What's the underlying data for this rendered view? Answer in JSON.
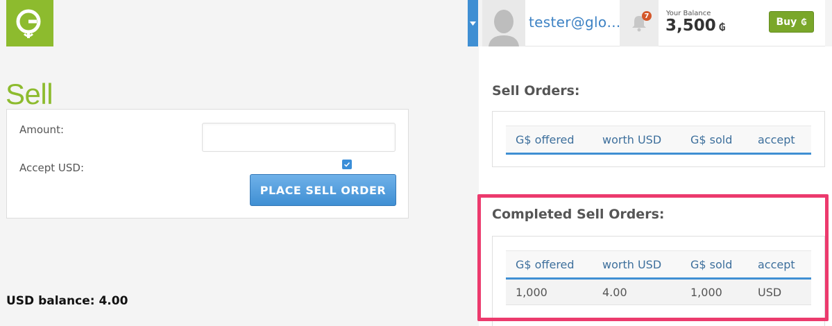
{
  "header": {
    "username": "tester@glo…",
    "notifications_count": "7",
    "balance_label": "Your Balance",
    "balance_value": "3,500",
    "currency_symbol": "₲",
    "buy_label": "Buy"
  },
  "sell_form": {
    "title": "Sell",
    "amount_label": "Amount:",
    "amount_value": "",
    "accept_usd_label": "Accept USD:",
    "accept_usd_checked": true,
    "submit_label": "PLACE SELL ORDER"
  },
  "usd_balance": {
    "label": "USD balance:",
    "value": "4.00"
  },
  "sell_orders": {
    "title": "Sell Orders:",
    "columns": [
      "G$ offered",
      "worth USD",
      "G$ sold",
      "accept"
    ]
  },
  "completed_orders": {
    "title": "Completed Sell Orders:",
    "columns": [
      "G$ offered",
      "worth USD",
      "G$ sold",
      "accept"
    ],
    "rows": [
      [
        "1,000",
        "4.00",
        "1,000",
        "USD"
      ]
    ]
  },
  "colors": {
    "brand_green": "#8dbb2e",
    "accent_blue": "#3f8fd3",
    "highlight_pink": "#ec3a6d"
  }
}
